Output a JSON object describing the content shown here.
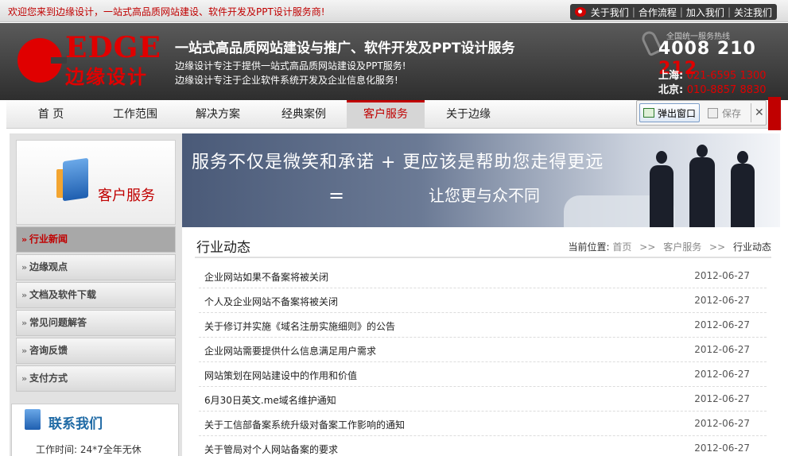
{
  "topbar": {
    "welcome": "欢迎您来到边缘设计，一站式高品质网站建设、软件开发及PPT设计服务商!",
    "links": [
      "关于我们",
      "合作流程",
      "加入我们",
      "关注我们"
    ]
  },
  "header": {
    "logo_en": "EDGE",
    "logo_cn": "边缘设计",
    "slogan": "一站式高品质网站建设与推广、软件开发及PPT设计服务",
    "desc1": "边缘设计专注于提供一站式高品质网站建设及PPT服务!",
    "desc2": "边缘设计专注于企业软件系统开发及企业信息化服务!",
    "hotline_label": "全国统一服务热线",
    "hotline_main": "4008 210 ",
    "hotline_tail": "212",
    "sh_label": "上海:",
    "sh_phone": "021-6595 1300",
    "bj_label": "北京:",
    "bj_phone": "010-8857 8830"
  },
  "nav": {
    "items": [
      "首 页",
      "工作范围",
      "解决方案",
      "经典案例",
      "客户服务",
      "关于边缘"
    ],
    "active": "客户服务"
  },
  "popup": {
    "open_label": "弹出窗口",
    "save_label": "保存",
    "close_label": "✕"
  },
  "sidebar": {
    "title": "客户服务",
    "items": [
      "行业新闻",
      "边缘观点",
      "文档及软件下载",
      "常见问题解答",
      "咨询反馈",
      "支付方式"
    ],
    "active": "行业新闻",
    "contact_title": "联系我们",
    "contact_hours": "工作时间: 24*7全年无休"
  },
  "banner": {
    "line1": "服务不仅是微笑和承诺 + 更应该是帮助您走得更远",
    "eq": "=",
    "line2": "让您更与众不同"
  },
  "content": {
    "title": "行业动态",
    "crumb_label": "当前位置:",
    "crumb_home": "首页",
    "crumb_sep": ">>",
    "crumb_section": "客户服务",
    "crumb_current": "行业动态",
    "news": [
      {
        "title": "企业网站如果不备案将被关闭",
        "date": "2012-06-27"
      },
      {
        "title": "个人及企业网站不备案将被关闭",
        "date": "2012-06-27"
      },
      {
        "title": "关于修订并实施《域名注册实施细则》的公告",
        "date": "2012-06-27"
      },
      {
        "title": "企业网站需要提供什么信息满足用户需求",
        "date": "2012-06-27"
      },
      {
        "title": "网站策划在网站建设中的作用和价值",
        "date": "2012-06-27"
      },
      {
        "title": "6月30日英文.me域名维护通知",
        "date": "2012-06-27"
      },
      {
        "title": "关于工信部备案系统升级对备案工作影响的通知",
        "date": "2012-06-27"
      },
      {
        "title": "关于管局对个人网站备案的要求",
        "date": "2012-06-27"
      }
    ]
  },
  "colors": {
    "brand_red": "#c00000",
    "header_dark": "#3a3a3a",
    "contact_blue": "#1f6aa5"
  }
}
